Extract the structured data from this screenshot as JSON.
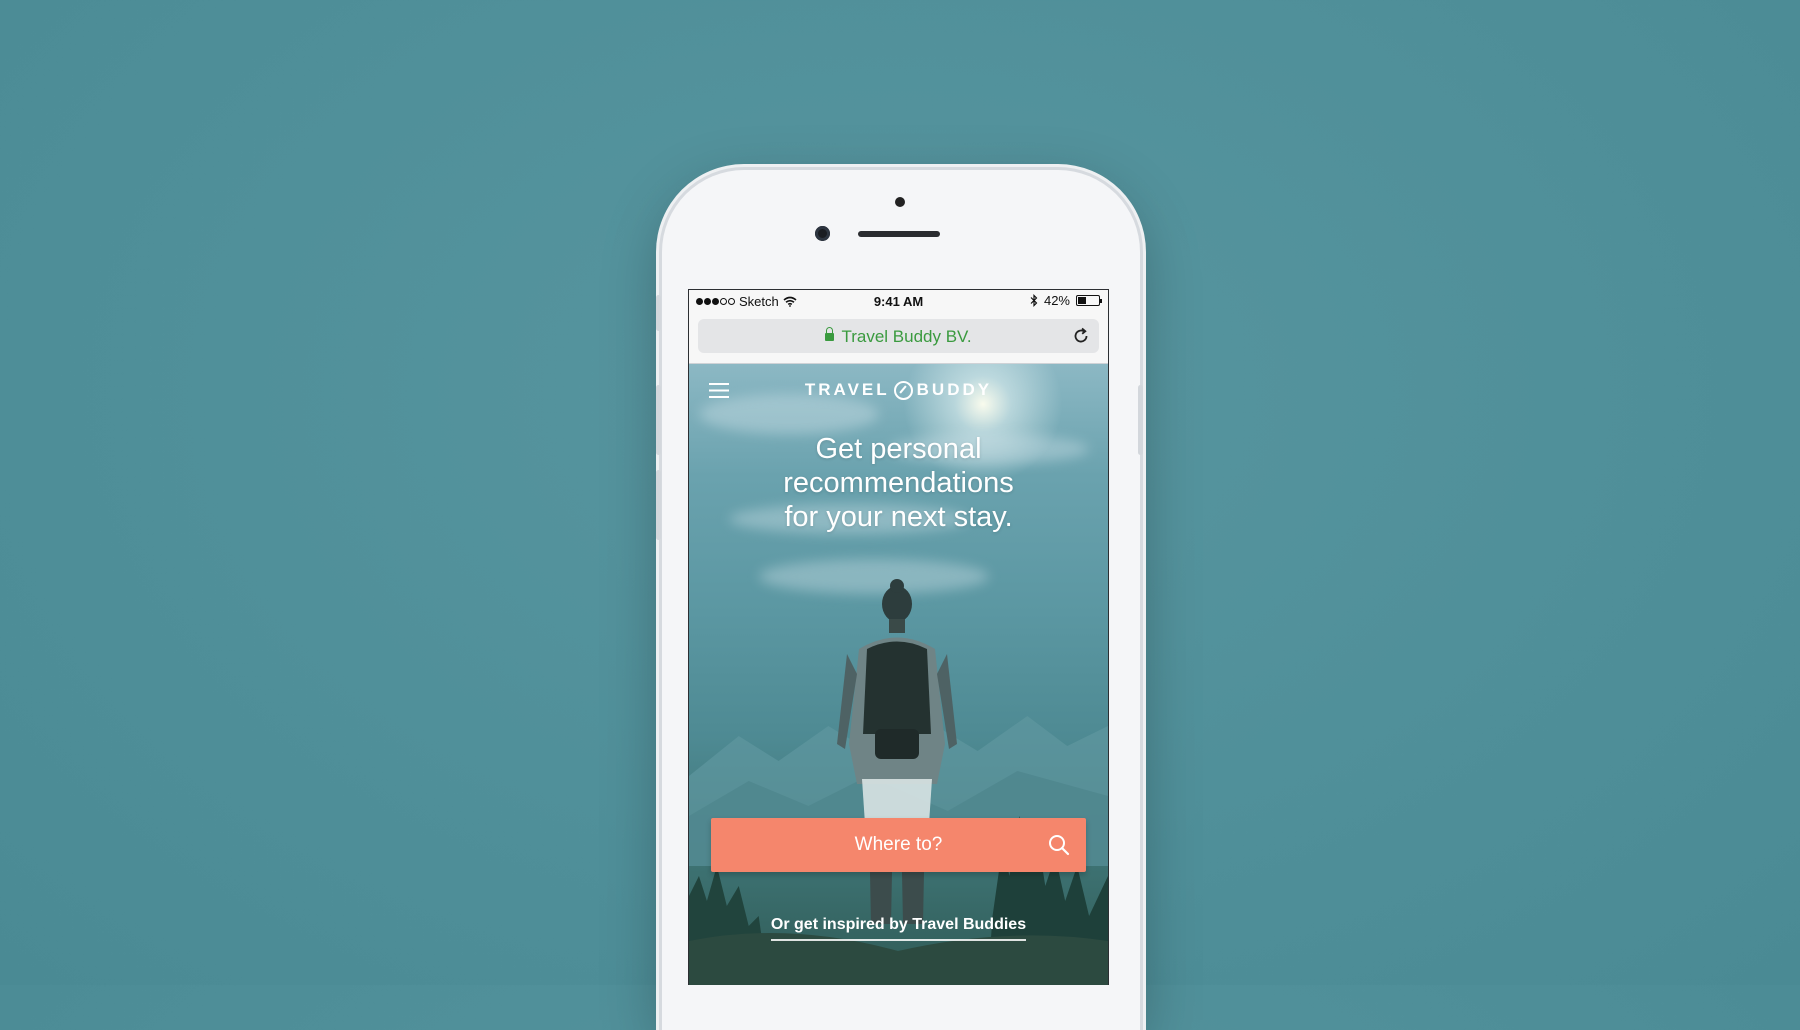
{
  "status_bar": {
    "carrier": "Sketch",
    "time": "9:41 AM",
    "battery_percent": "42%",
    "battery_level": 0.42,
    "signal_bars_filled": 3,
    "signal_bars_total": 5,
    "icons": [
      "wifi-icon",
      "bluetooth-icon",
      "battery-icon"
    ]
  },
  "address_bar": {
    "site_name": "Travel Buddy BV.",
    "secure": true,
    "icons": [
      "lock-icon",
      "reload-icon"
    ],
    "accent_color": "#3a9a3f"
  },
  "app": {
    "logo_left": "TRAVEL",
    "logo_right": "BUDDY",
    "headline_lines": [
      "Get personal",
      "recommendations",
      "for your next stay."
    ],
    "search_button_label": "Where to?",
    "inspire_link": "Or get inspired by Travel Buddies",
    "accent_color": "#f5866c",
    "icons": [
      "menu-icon",
      "compass-icon",
      "search-icon"
    ]
  }
}
